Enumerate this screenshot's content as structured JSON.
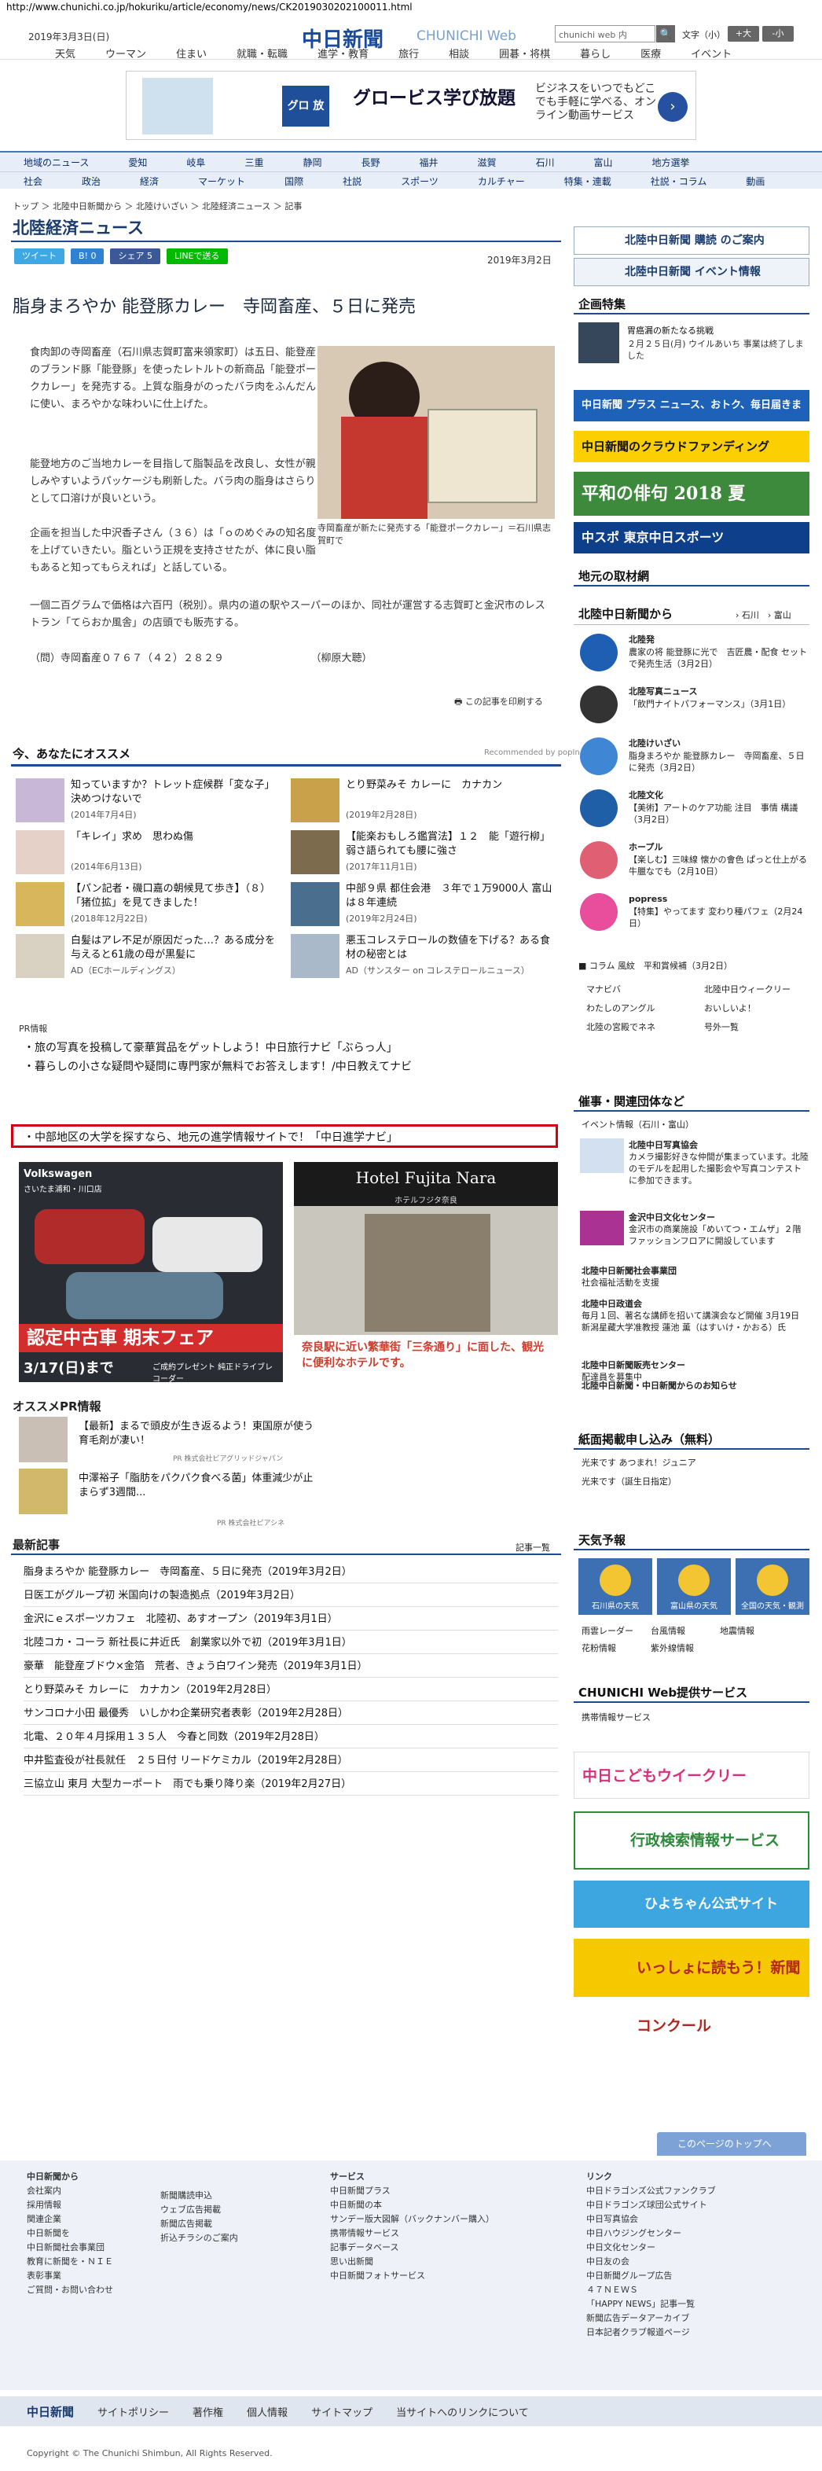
{
  "url": "http://www.chunichi.co.jp/hokuriku/article/economy/news/CK2019030202100011.html",
  "header": {
    "date": "2019年3月3日(日)",
    "logo": "中日新聞",
    "logo_sub": "CHUNICHI Web",
    "search_placeholder": "chunichi web 内",
    "search_btn": "🔍",
    "font_size_label": "文字（小）",
    "font_up": "+大",
    "font_down": "-小"
  },
  "gnav": [
    "天気",
    "ウーマン",
    "住まい",
    "就職・転職",
    "進学・教育",
    "旅行",
    "相談",
    "囲碁・将棋",
    "暮らし",
    "医療",
    "イベント"
  ],
  "ad_banner": {
    "brand": "グロ 放題",
    "title": "グロービス学び放題",
    "text": "ビジネスをいつでもどこでも手軽に学べる、オンライン動画サービス"
  },
  "secnav": {
    "row1": [
      "地域のニュース",
      "愛知",
      "岐阜",
      "三重",
      "静岡",
      "長野",
      "福井",
      "滋賀",
      "石川",
      "富山",
      "地方選挙"
    ],
    "row2": [
      "社会",
      "政治",
      "経済",
      "マーケット",
      "国際",
      "社説",
      "スポーツ",
      "カルチャー",
      "特集・連載",
      "社説・コラム",
      "動画"
    ]
  },
  "breadcrumb": "トップ ＞ 北陸中日新聞から ＞ 北陸けいざい ＞ 北陸経済ニュース ＞ 記事",
  "page_title": "北陸経済ニュース",
  "social": [
    "ツイート",
    "B! 0",
    "シェア 5",
    "LINEで送る"
  ],
  "article": {
    "date": "2019年3月2日",
    "headline": "脂身まろやか 能登豚カレー　寺岡畜産、５日に発売",
    "p1": "食肉卸の寺岡畜産（石川県志賀町富来領家町）は五日、能登産のブランド豚「能登豚」を使ったレトルトの新商品「能登ポークカレー」を発売する。上質な脂身がのったバラ肉をふんだんに使い、まろやかな味わいに仕上げた。",
    "p2": "能登地方のご当地カレーを目指して脂製品を改良し、女性が親しみやすいようパッケージも刷新した。バラ肉の脂身はさらりとして口溶けが良いという。",
    "p3": "企画を担当した中沢香子さん（３６）は「ｏのめぐみの知名度を上げていきたい。脂という正規を支持させたが、体に良い脂もあると知ってもらえれば」と話している。",
    "p4": "一個二百グラムで価格は六百円（税別）。県内の道の駅やスーパーのほか、同社が運営する志賀町と金沢市のレストラン「てらおか風舎」の店頭でも販売する。",
    "p5": "（問）寺岡畜産０７６７（４２）２８２９　　　　　　　　　（柳原大聴）",
    "photo_caption": "寺岡畜産が新たに発売する「能登ポークカレー」＝石川県志賀町で",
    "print_label": "この記事を印刷する"
  },
  "recommend": {
    "heading": "今、あなたにオススメ",
    "by": "Recommended by popIn",
    "items": [
      {
        "title": "知っていますか？トレット症候群「変な子」決めつけないで",
        "date": "(2014年7月4日)"
      },
      {
        "title": "とり野菜みそ カレーに　カナカン",
        "date": "(2019年2月28日)"
      },
      {
        "title": "「キレイ」求め　思わぬ傷",
        "date": "(2014年6月13日)"
      },
      {
        "title": "【能楽おもしろ鑑賞法】１２　能「遊行柳」　弱さ語られても腰に強さ",
        "date": "(2017年11月1日)"
      },
      {
        "title": "【パン記者・磯口嘉の朝候見て歩き】（８）　「猪位拡」を見てきました！",
        "date": "(2018年12月22日)"
      },
      {
        "title": "中部９県 都住会港　３年で１万9000人 富山は８年連続",
        "date": "(2019年2月24日)"
      },
      {
        "title": "白髪はアレ不足が原因だった…？ある成分を与えると61歳の母が黒髪に",
        "date": "AD（ECホールディングス）"
      },
      {
        "title": "悪玉コレステロールの数値を下げる？ある食材の秘密とは",
        "date": "AD（サンスター on コレステロールニュース）"
      }
    ]
  },
  "pr": {
    "heading": "PR情報",
    "links": [
      "・旅の写真を投稿して豪華賞品をゲットしよう！中日旅行ナビ「ぶらっ人」",
      "・暮らしの小さな疑問や疑問に専門家が無料でお答えします！/中日教えてナビ",
      "・中部地区の大学を探すなら、地元の進学情報サイトで！「中日進学ナビ」"
    ]
  },
  "ads": {
    "vw_brand": "Volkswagen",
    "vw_dealer": "さいたま浦和・川口店",
    "vw_fair": "認定中古車 期末フェア",
    "vw_date": "3/17(日)まで",
    "vw_sub": "ご成約プレゼント 純正ドライブレコーダー",
    "hotel_name": "Hotel Fujita Nara",
    "hotel_jp": "ホテルフジタ奈良",
    "hotel_copy": "奈良駅に近い繁華街「三条通り」に面した、観光に便利なホテルです。"
  },
  "ospr": {
    "heading": "オススメPR情報",
    "items": [
      {
        "title": "【最新】まるで頭皮が生き返るよう！東国原が使う育毛剤が凄い！",
        "by": "PR 株式会社ビアグリッドジャパン"
      },
      {
        "title": "中澤裕子「脂肪をパクパク食べる菌」体重減少が止まらず3週間...",
        "by": "PR 株式会社ピアシネ"
      }
    ]
  },
  "latest": {
    "heading": "最新記事",
    "more": "記事一覧",
    "items": [
      "脂身まろやか 能登豚カレー　寺岡畜産、５日に発売（2019年3月2日）",
      "日医工がグループ初 米国向けの製造拠点（2019年3月2日）",
      "金沢にｅスポーツカフェ　北陸初、あすオープン（2019年3月1日）",
      "北陸コカ・コーラ 新社長に井近氏　創業家以外で初（2019年3月1日）",
      "豪華　能登産ブドウ×金箔　荒者、きょう白ワイン発売（2019年3月1日）",
      "とり野菜みそ カレーに　カナカン（2019年2月28日）",
      "サンコロナ小田 最優秀　いしかわ企業研究者表彰（2019年2月28日）",
      "北電、２０年４月採用１３５人　今春と同数（2019年2月28日）",
      "中井監査役が社長就任　２５日付 リードケミカル（2019年2月28日）",
      "三協立山 東月 大型カーポート　雨でも乗り降り楽（2019年2月27日）"
    ]
  },
  "sidebar": {
    "btn1": "北陸中日新聞 購読 のご案内",
    "btn2": "北陸中日新聞 イベント情報",
    "kikaku_heading": "企画特集",
    "kikaku_title": "胃癌漏の新たなる挑戦",
    "kikaku_text": "２月２５日(月) ウイルあいち 事業は終了しました",
    "b1": "中日新聞 プラス ニュース、おトク、毎日届きます",
    "b2": "中日新聞のクラウドファンディング",
    "b3": "平和の俳句 2018 夏",
    "b4": "中スポ 東京中日スポーツ",
    "torizai": "地元の取材網",
    "from_heading": "北陸中日新聞から",
    "from_links": "› 石川　› 富山",
    "from_items": [
      {
        "label": "北陸発",
        "text": "農家の将 能登豚に光で　吉匠農・配食 セットで発売生活（3月2日）"
      },
      {
        "label": "北陸写真ニュース",
        "text": "「飲門ナイトパフォーマンス」（3月1日）"
      },
      {
        "label": "北陸けいざい",
        "text": "脂身まろやか 能登豚カレー　寺岡畜産、５日に発売（3月2日）"
      },
      {
        "label": "北陸文化",
        "text": "【美術】アートのケア功能 注目　事情 構議（3月2日）"
      },
      {
        "label": "ホープル",
        "text": "【楽しむ】三味線 懐かの會色 ぱっと仕上がる 牛臘なでも（2月10日）"
      },
      {
        "label": "popress",
        "text": "【特集】やってます 変わり種パフェ（2月24日）"
      }
    ],
    "column_line": "■ コラム 風紋　平和賞候補（3月2日）",
    "mini_links": [
      "マナビバ",
      "北陸中日ウィークリー",
      "わたしのアングル",
      "おいしいよ！",
      "北陸の宮殿でネネ",
      "号外一覧"
    ],
    "jigyo_heading": "催事・関連団体など",
    "event_info": "イベント情報（石川・富山）",
    "jigyo_items": [
      {
        "label": "北陸中日写真協会",
        "text": "カメラ撮影好きな仲間が集まっています。北陸のモデルを起用した撮影会や写真コンテストに参加できます。"
      },
      {
        "label": "金沢中日文化センター",
        "text": "金沢市の商業施設「めいてつ・エムザ」２階ファッションフロアに開設しています"
      },
      {
        "label": "北陸中日新聞社会事業団",
        "text": "社会福祉活動を支援"
      },
      {
        "label": "北陸中日政道会",
        "text": "毎月１回、著名な講師を招いて講演会など開催 3月19日 新潟星藏大学准教授 蓮池 薫（はすいけ・かおる）氏"
      },
      {
        "label": "北陸中日新聞販売センター",
        "text": "配達員を募集中"
      },
      {
        "label": "北陸中日新聞・中日新聞からのお知らせ",
        "text": ""
      }
    ],
    "shimen_heading": "紙面掲載申し込み（無料）",
    "shimen_items": [
      "光来です あつまれ！ジュニア",
      "光来です（誕生日指定）"
    ],
    "weather_heading": "天気予報",
    "weather_labels": [
      "石川県の天気",
      "富山県の天気",
      "全国の天気・観測"
    ],
    "weather_links": [
      "雨雲レーダー",
      "台風情報",
      "地震情報",
      "花粉情報",
      "紫外線情報"
    ],
    "service_heading": "CHUNICHI Web提供サービス",
    "service_link": "携帯情報サービス",
    "sb_kodomo": "中日こどもウイークリー",
    "sb_gyosei": "行政検索情報サービス",
    "sb_hiyo": "ひよちゃん公式サイト",
    "sb_niec": "いっしょに読もう！新聞コンクール"
  },
  "footer": {
    "col1_head": "中日新聞から",
    "col1": [
      "会社案内",
      "採用情報",
      "関連企業",
      "中日新聞を",
      "中日新聞社会事業団",
      "教育に新聞を・ＮＩＥ",
      "表彰事業",
      "ご質問・お問い合わせ"
    ],
    "col2": [
      "新聞購読申込",
      "ウェブ広告掲載",
      "新聞広告掲載",
      "折込チラシのご案内"
    ],
    "col3_head": "サービス",
    "col3": [
      "中日新聞プラス",
      "中日新聞の本",
      "サンデー版大図解（バックナンバー購入）",
      "携帯情報サービス",
      "記事データベース",
      "思い出新聞",
      "中日新聞フォトサービス"
    ],
    "col4_head": "リンク",
    "col4": [
      "中日ドラゴンズ公式ファンクラブ",
      "中日ドラゴンズ球団公式サイト",
      "中日写真協会",
      "中日ハウジングセンター",
      "中日文化センター",
      "中日友の会",
      "中日新聞グループ広告",
      "４７ＮＥＷＳ",
      "「HAPPY NEWS」記事一覧",
      "新聞広告データアーカイブ",
      "日本記者クラブ報道ページ"
    ],
    "top_link": "このページのトップへ",
    "bottom": [
      "中日新聞",
      "サイトポリシー",
      "著作権",
      "個人情報",
      "サイトマップ",
      "当サイトへのリンクについて"
    ],
    "copyright": "Copyright © The Chunichi Shimbun, All Rights Reserved."
  }
}
